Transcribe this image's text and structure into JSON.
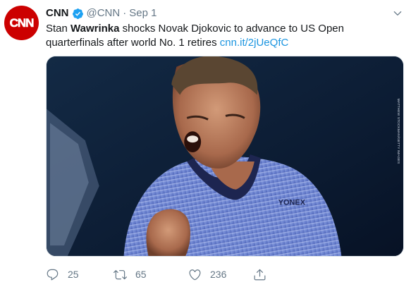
{
  "tweet": {
    "author_name": "CNN",
    "handle": "@CNN",
    "separator": "·",
    "timestamp": "Sep 1",
    "text_before": "Stan ",
    "text_bold": "Wawrinka",
    "text_after": " shocks Novak Djokovic to advance to US Open quarterfinals after world No. 1 retires ",
    "link_text": "cnn.it/2jUeQfC",
    "avatar_text": "CNN",
    "media_credit": "MATTHEW STOCKMAN/GETTY IMAGES",
    "shirt_logo": "YONEX"
  },
  "actions": {
    "reply_count": "25",
    "retweet_count": "65",
    "like_count": "236"
  },
  "colors": {
    "brand_red": "#cc0000",
    "link_blue": "#1b95e0",
    "muted_gray": "#657786",
    "verified_blue": "#1da1f2"
  },
  "icons": {
    "verified": "verified-badge-icon",
    "caret": "chevron-down-icon",
    "reply": "reply-icon",
    "retweet": "retweet-icon",
    "like": "heart-icon",
    "share": "share-icon"
  }
}
